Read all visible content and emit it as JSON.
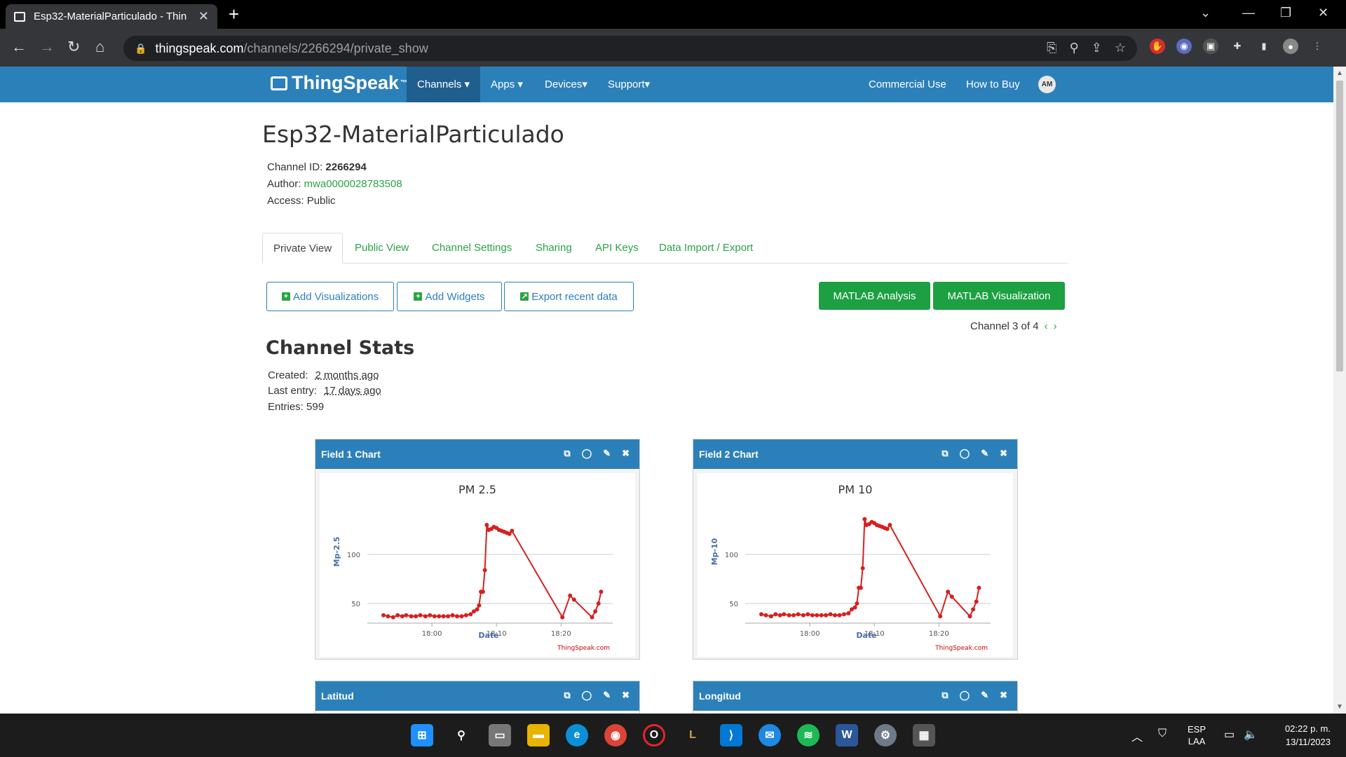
{
  "browser": {
    "tab_title": "Esp32-MaterialParticulado - Thin",
    "url_domain": "thingspeak.com",
    "url_path": "/channels/2266294/private_show"
  },
  "nav": {
    "brand": "ThingSpeak",
    "brand_tm": "™",
    "items": [
      "Channels ▾",
      "Apps ▾",
      "Devices▾",
      "Support▾"
    ],
    "right_items": [
      "Commercial Use",
      "How to Buy"
    ],
    "avatar_initials": "AM"
  },
  "channel": {
    "title": "Esp32-MaterialParticulado",
    "id_label": "Channel ID:",
    "id_value": "2266294",
    "author_label": "Author:",
    "author_value": "mwa0000028783508",
    "access_label": "Access:",
    "access_value": "Public"
  },
  "tabs": [
    "Private View",
    "Public View",
    "Channel Settings",
    "Sharing",
    "API Keys",
    "Data Import / Export"
  ],
  "buttons": {
    "add_visualizations": "Add Visualizations",
    "add_widgets": "Add Widgets",
    "export_recent": "Export recent data",
    "matlab_analysis": "MATLAB Analysis",
    "matlab_visualization": "MATLAB Visualization"
  },
  "channel_nav": {
    "text": "Channel 3 of 4",
    "prev": "‹",
    "next": "›"
  },
  "stats": {
    "heading": "Channel Stats",
    "created_label": "Created:",
    "created_value": "2 months ago",
    "last_entry_label": "Last entry:",
    "last_entry_value": "17 days ago",
    "entries_text": "Entries: 599"
  },
  "widgets": [
    {
      "title": "Field 1 Chart"
    },
    {
      "title": "Field 2 Chart"
    },
    {
      "title": "Latitud"
    },
    {
      "title": "Longitud"
    }
  ],
  "chart_data": [
    {
      "type": "line",
      "title": "PM 2.5",
      "xlabel": "Date",
      "ylabel": "Mp-2.5",
      "xticks": [
        "18:00",
        "18:10",
        "18:20"
      ],
      "yticks": [
        50,
        100
      ],
      "ylim": [
        30,
        140
      ],
      "credit": "ThingSpeak.com",
      "color": "#d62020",
      "x_minutes": [
        -7.5,
        -6.8,
        -6.0,
        -5.3,
        -4.6,
        -4.0,
        -3.2,
        -2.5,
        -1.8,
        -1.0,
        -0.3,
        0.4,
        1.1,
        1.8,
        2.5,
        3.2,
        3.9,
        4.6,
        5.3,
        6.0,
        6.5,
        7.0,
        7.3,
        7.6,
        7.9,
        8.2,
        8.5,
        8.8,
        9.2,
        9.6,
        10.0,
        10.4,
        10.8,
        11.2,
        11.6,
        12.0,
        12.4,
        20.2,
        21.4,
        22.0,
        24.8,
        25.3,
        25.8,
        26.2
      ],
      "values": [
        38,
        37,
        36,
        38,
        37,
        38,
        37,
        37,
        38,
        37,
        38,
        37,
        37,
        37,
        37,
        38,
        37,
        37,
        38,
        39,
        42,
        44,
        48,
        62,
        62,
        84,
        130,
        125,
        126,
        128,
        127,
        125,
        124,
        123,
        122,
        121,
        124,
        36,
        58,
        54,
        36,
        42,
        50,
        62
      ]
    },
    {
      "type": "line",
      "title": "PM 10",
      "xlabel": "Date",
      "ylabel": "Mp-10",
      "xticks": [
        "18:00",
        "18:10",
        "18:20"
      ],
      "yticks": [
        50,
        100
      ],
      "ylim": [
        30,
        140
      ],
      "credit": "ThingSpeak.com",
      "color": "#d62020",
      "x_minutes": [
        -7.5,
        -6.8,
        -6.0,
        -5.3,
        -4.6,
        -4.0,
        -3.2,
        -2.5,
        -1.8,
        -1.0,
        -0.3,
        0.4,
        1.1,
        1.8,
        2.5,
        3.2,
        3.9,
        4.6,
        5.3,
        6.0,
        6.5,
        7.0,
        7.3,
        7.6,
        7.9,
        8.2,
        8.5,
        8.8,
        9.2,
        9.6,
        10.0,
        10.4,
        10.8,
        11.2,
        11.6,
        12.0,
        12.4,
        20.2,
        21.4,
        22.0,
        24.8,
        25.3,
        25.8,
        26.2
      ],
      "values": [
        39,
        38,
        37,
        39,
        38,
        39,
        38,
        38,
        39,
        38,
        39,
        38,
        38,
        38,
        38,
        39,
        38,
        38,
        39,
        40,
        44,
        46,
        50,
        66,
        66,
        86,
        136,
        130,
        131,
        133,
        132,
        130,
        129,
        128,
        127,
        126,
        130,
        37,
        62,
        57,
        37,
        44,
        52,
        66
      ]
    }
  ],
  "taskbar": {
    "lang_top": "ESP",
    "lang_bottom": "LAA",
    "time": "02:22 p. m.",
    "date": "13/11/2023"
  }
}
